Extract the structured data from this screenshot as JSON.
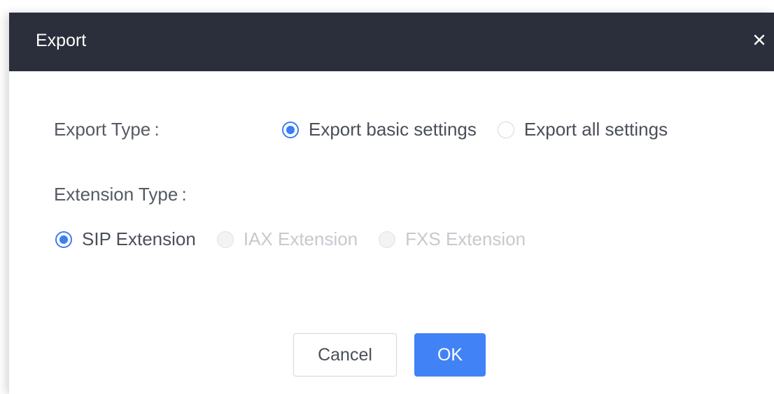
{
  "dialog": {
    "title": "Export",
    "close_icon": "close-icon"
  },
  "export_type": {
    "label": "Export Type :",
    "options": [
      {
        "label": "Export basic settings",
        "checked": true,
        "disabled": false
      },
      {
        "label": "Export all settings",
        "checked": false,
        "disabled": false
      }
    ]
  },
  "extension_type": {
    "label": "Extension Type :",
    "options": [
      {
        "label": "SIP Extension",
        "checked": true,
        "disabled": false
      },
      {
        "label": "IAX Extension",
        "checked": false,
        "disabled": true
      },
      {
        "label": "FXS Extension",
        "checked": false,
        "disabled": true
      }
    ]
  },
  "buttons": {
    "cancel_label": "Cancel",
    "ok_label": "OK"
  },
  "colors": {
    "header_bg": "#2b2f3b",
    "accent": "#3c7cf6",
    "ok_button": "#4183f6"
  }
}
